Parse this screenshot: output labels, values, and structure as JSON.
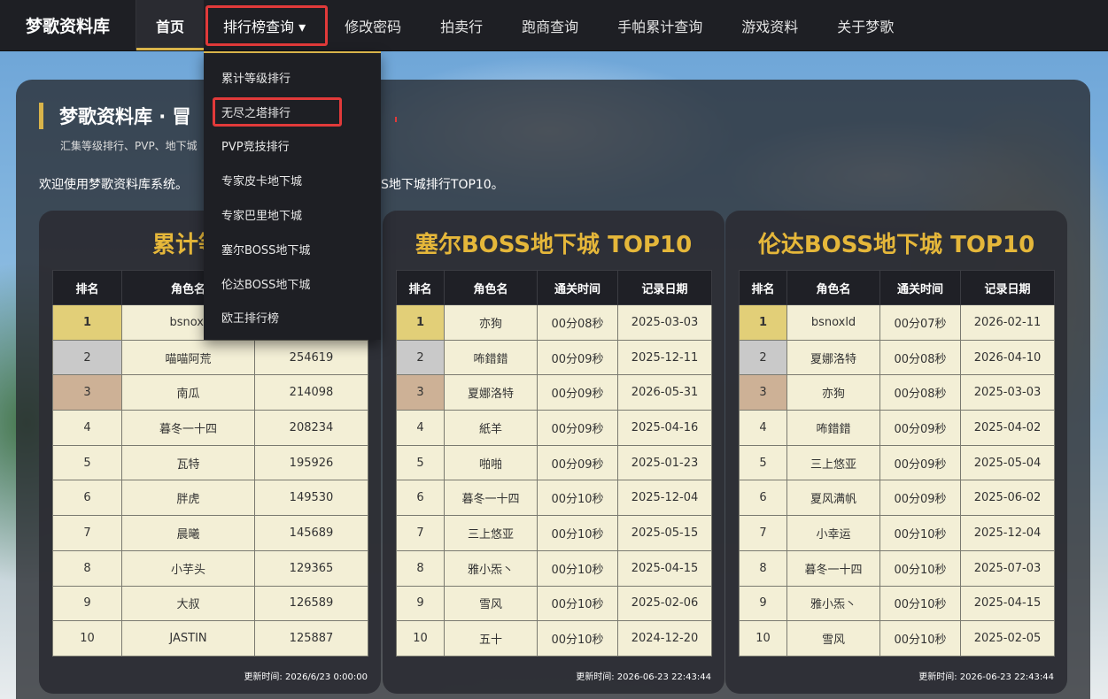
{
  "brand": "梦歌资料库",
  "nav": [
    {
      "label": "首页"
    },
    {
      "label": "排行榜查询 ▾"
    },
    {
      "label": "修改密码"
    },
    {
      "label": "拍卖行"
    },
    {
      "label": "跑商查询"
    },
    {
      "label": "手帕累计查询"
    },
    {
      "label": "游戏资料"
    },
    {
      "label": "关于梦歌"
    }
  ],
  "dropdown": [
    "累计等级排行",
    "无尽之塔排行",
    "PVP竞技排行",
    "专家皮卡地下城",
    "专家巴里地下城",
    "塞尔BOSS地下城",
    "伦达BOSS地下城",
    "欧王排行榜"
  ],
  "hero": {
    "title": "梦歌资料库 · 冒",
    "subtitle": "汇集等级排行、PVP、地下城",
    "welcome": "欢迎使用梦歌资料库系统。",
    "welcome_tail": "S地下城排行TOP10。"
  },
  "colors": {
    "accent": "#d9b44a",
    "title_gold": "#e5b73a",
    "highlight_red": "#e23a3a",
    "rank1": "#e2cf78",
    "rank2": "#c9c9c9",
    "rank3": "#cdb196"
  },
  "cards": [
    {
      "title": "累计等级排",
      "headers": [
        "排名",
        "角色名",
        ""
      ],
      "rows": [
        [
          "1",
          "bsnoxl",
          ""
        ],
        [
          "2",
          "喵喵阿荒",
          "254619"
        ],
        [
          "3",
          "南瓜",
          "214098"
        ],
        [
          "4",
          "暮冬一十四",
          "208234"
        ],
        [
          "5",
          "瓦特",
          "195926"
        ],
        [
          "6",
          "胖虎",
          "149530"
        ],
        [
          "7",
          "晨曦",
          "145689"
        ],
        [
          "8",
          "小芋头",
          "129365"
        ],
        [
          "9",
          "大叔",
          "126589"
        ],
        [
          "10",
          "JASTIN",
          "125887"
        ]
      ],
      "update": "更新时间: 2026/6/23 0:00:00"
    },
    {
      "title": "塞尔BOSS地下城 TOP10",
      "headers": [
        "排名",
        "角色名",
        "通关时间",
        "记录日期"
      ],
      "rows": [
        [
          "1",
          "亦狗",
          "00分08秒",
          "2025-03-03"
        ],
        [
          "2",
          "咘錯錯",
          "00分09秒",
          "2025-12-11"
        ],
        [
          "3",
          "夏娜洛特",
          "00分09秒",
          "2026-05-31"
        ],
        [
          "4",
          "紙羊",
          "00分09秒",
          "2025-04-16"
        ],
        [
          "5",
          "啪啪",
          "00分09秒",
          "2025-01-23"
        ],
        [
          "6",
          "暮冬一十四",
          "00分10秒",
          "2025-12-04"
        ],
        [
          "7",
          "三上悠亚",
          "00分10秒",
          "2025-05-15"
        ],
        [
          "8",
          "雅小炁丶",
          "00分10秒",
          "2025-04-15"
        ],
        [
          "9",
          "雪风",
          "00分10秒",
          "2025-02-06"
        ],
        [
          "10",
          "五十",
          "00分10秒",
          "2024-12-20"
        ]
      ],
      "update": "更新时间: 2026-06-23 22:43:44"
    },
    {
      "title": "伦达BOSS地下城 TOP10",
      "headers": [
        "排名",
        "角色名",
        "通关时间",
        "记录日期"
      ],
      "rows": [
        [
          "1",
          "bsnoxld",
          "00分07秒",
          "2026-02-11"
        ],
        [
          "2",
          "夏娜洛特",
          "00分08秒",
          "2026-04-10"
        ],
        [
          "3",
          "亦狗",
          "00分08秒",
          "2025-03-03"
        ],
        [
          "4",
          "咘錯錯",
          "00分09秒",
          "2025-04-02"
        ],
        [
          "5",
          "三上悠亚",
          "00分09秒",
          "2025-05-04"
        ],
        [
          "6",
          "夏风满帆",
          "00分09秒",
          "2025-06-02"
        ],
        [
          "7",
          "小幸运",
          "00分10秒",
          "2025-12-04"
        ],
        [
          "8",
          "暮冬一十四",
          "00分10秒",
          "2025-07-03"
        ],
        [
          "9",
          "雅小炁丶",
          "00分10秒",
          "2025-04-15"
        ],
        [
          "10",
          "雪风",
          "00分10秒",
          "2025-02-05"
        ]
      ],
      "update": "更新时间: 2026-06-23 22:43:44"
    }
  ]
}
